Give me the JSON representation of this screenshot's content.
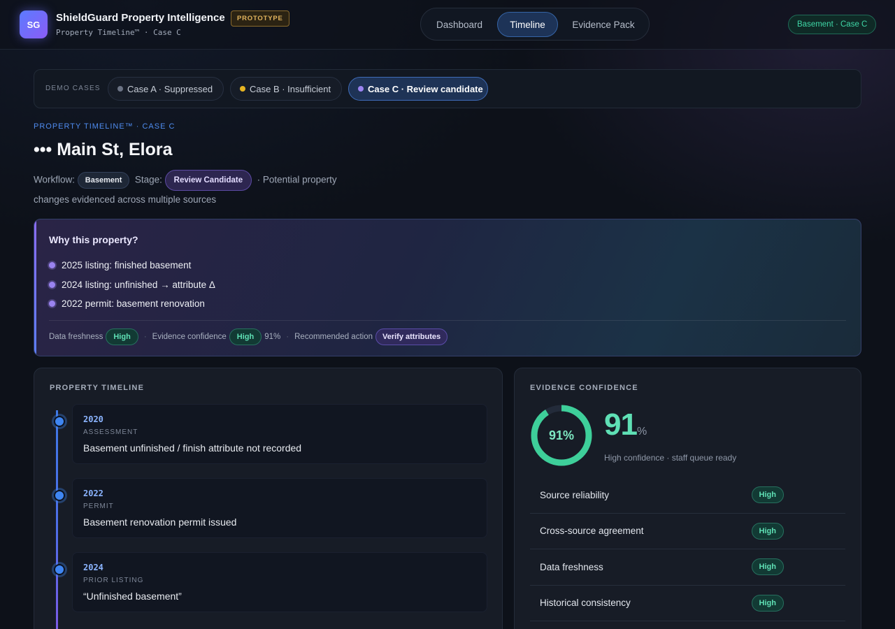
{
  "header": {
    "logo_text": "SG",
    "app_title": "ShieldGuard Property Intelligence",
    "subtitle": "Property Timeline™ · Case C",
    "badge": "PROTOTYPE",
    "nav": [
      "Dashboard",
      "Timeline",
      "Evidence Pack"
    ],
    "active_nav": "Timeline",
    "case_pill": "Basement · Case C"
  },
  "demo": {
    "label": "DEMO CASES",
    "cases": [
      {
        "label": "Case A · Suppressed",
        "dot_color": "#6b7384"
      },
      {
        "label": "Case B · Insufficient",
        "dot_color": "#e6b422"
      },
      {
        "label": "Case C · Review candidate",
        "dot_color": "#9a83f0"
      }
    ],
    "active_index": 2
  },
  "property": {
    "eyebrow": "PROPERTY TIMELINE™ · CASE C",
    "address": "••• Main St, Elora",
    "workflow_label": "Workflow:",
    "workflow": "Basement",
    "stage_label": "Stage:",
    "stage": "Review Candidate",
    "description": "· Potential property changes evidenced across multiple sources"
  },
  "why": {
    "title": "Why this property?",
    "reasons": [
      "2025 listing: finished basement",
      "2024 listing: unfinished → attribute Δ",
      "2022 permit: basement renovation"
    ],
    "freshness_label": "Data freshness",
    "freshness": "High",
    "confidence_label": "Evidence confidence",
    "confidence": "High",
    "confidence_pct": "91%",
    "action_label": "Recommended action",
    "action": "Verify attributes"
  },
  "timeline": {
    "title": "PROPERTY TIMELINE",
    "events": [
      {
        "year": "2020",
        "category": "ASSESSMENT",
        "description": "Basement unfinished / finish attribute not recorded"
      },
      {
        "year": "2022",
        "category": "PERMIT",
        "description": "Basement renovation permit issued"
      },
      {
        "year": "2024",
        "category": "PRIOR LISTING",
        "description": "“Unfinished basement”"
      }
    ]
  },
  "confidence": {
    "title": "EVIDENCE CONFIDENCE",
    "value": 91,
    "ring_label": "91%",
    "big_value": "91",
    "big_unit": "%",
    "caption": "High confidence · staff queue ready",
    "factors": [
      {
        "label": "Source reliability",
        "level": "High"
      },
      {
        "label": "Cross-source agreement",
        "level": "High"
      },
      {
        "label": "Data freshness",
        "level": "High"
      },
      {
        "label": "Historical consistency",
        "level": "High"
      }
    ],
    "accent_color": "#3ecf9a"
  }
}
